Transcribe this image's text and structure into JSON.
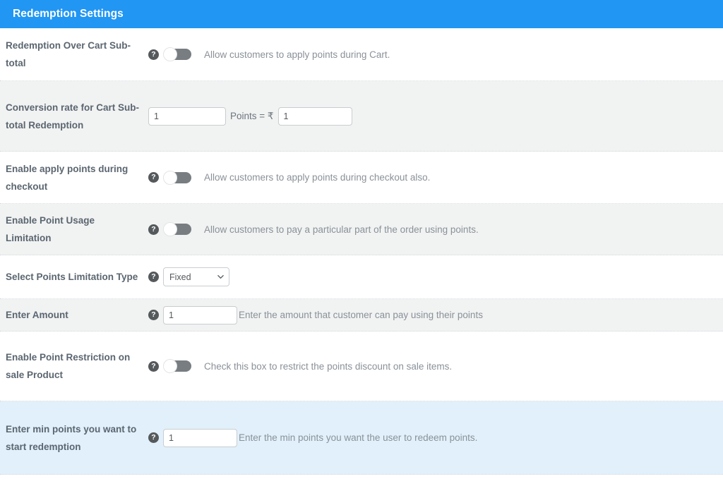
{
  "header": {
    "title": "Redemption Settings",
    "accent_color": "#2196f3"
  },
  "colors": {
    "row_white": "#ffffff",
    "row_gray": "#f1f2f2",
    "row_highlight_blue": "#e1f0fb",
    "label_text": "#5b6670",
    "description_text": "#8a9198",
    "toggle_track_off": "#787d82"
  },
  "help_icon_glyph": "?",
  "rows": [
    {
      "label": "Redemption Over Cart Sub-total",
      "control": "toggle",
      "toggle_state": "off",
      "description": "Allow customers to apply points during Cart.",
      "background": "white"
    },
    {
      "label": "Conversion rate for Cart Sub-total Redemption",
      "control": "conversion",
      "points_value": "1",
      "separator_text": "Points = ₹",
      "currency_value": "1",
      "background": "gray"
    },
    {
      "label": "Enable apply points during checkout",
      "control": "toggle",
      "toggle_state": "off",
      "description": "Allow customers to apply points during checkout also.",
      "background": "white"
    },
    {
      "label": "Enable Point Usage Limitation",
      "control": "toggle",
      "toggle_state": "off",
      "description": "Allow customers to pay a particular part of the order using points.",
      "background": "gray"
    },
    {
      "label": "Select Points Limitation Type",
      "control": "select",
      "selected_option": "Fixed",
      "options": [
        "Fixed"
      ],
      "background": "white"
    },
    {
      "label": "Enter Amount",
      "control": "input",
      "value": "1",
      "description": "Enter the amount that customer can pay using their points",
      "background": "gray"
    },
    {
      "label": "Enable Point Restriction on sale Product",
      "control": "toggle",
      "toggle_state": "off",
      "description": "Check this box to restrict the points discount on sale items.",
      "background": "white"
    },
    {
      "label": "Enter min points you want to start redemption",
      "control": "input",
      "value": "1",
      "description": "Enter the min points you want the user to redeem points.",
      "background": "blue"
    }
  ]
}
